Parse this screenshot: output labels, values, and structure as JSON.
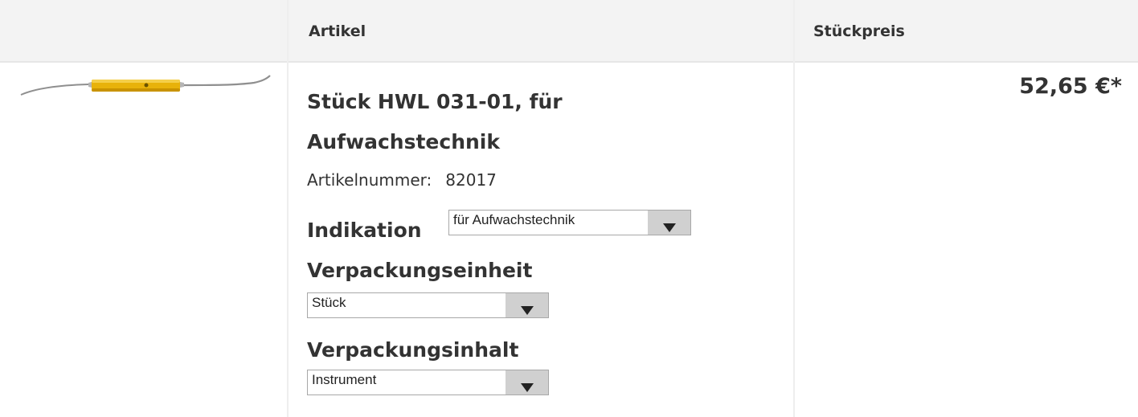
{
  "table": {
    "headers": {
      "article": "Artikel",
      "unit_price": "Stückpreis"
    }
  },
  "product": {
    "title": "Stück HWL 031-01, für Aufwachstechnik",
    "article_number_label": "Artikelnummer:",
    "article_number": "82017",
    "price": "52,65 €*",
    "image_icon": "dental-wax-instrument-icon",
    "options": {
      "indikation": {
        "label": "Indikation",
        "selected": "für Aufwachstechnik"
      },
      "verpackungseinheit": {
        "label": "Verpackungseinheit",
        "selected": "Stück"
      },
      "verpackungsinhalt": {
        "label": "Verpackungsinhalt",
        "selected": "Instrument"
      }
    }
  },
  "colors": {
    "handle": "#e8b20a",
    "header_bg": "#f3f3f3",
    "text": "#333333",
    "dropdown_button": "#d0d0d0"
  }
}
